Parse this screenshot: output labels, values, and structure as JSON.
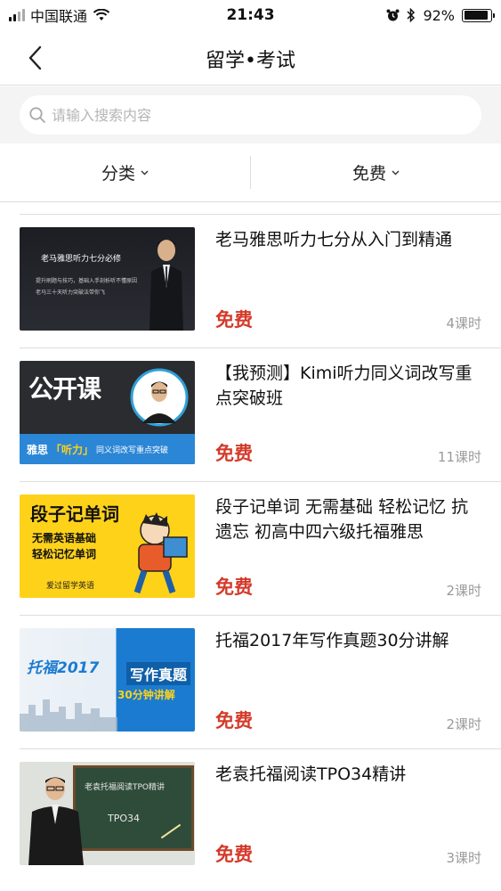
{
  "status_bar": {
    "carrier": "中国联通",
    "time": "21:43",
    "battery": "92%",
    "battery_level": 0.92
  },
  "nav": {
    "title": "留学•考试",
    "back_icon": "chevron-left-icon"
  },
  "search": {
    "placeholder": "请输入搜索内容",
    "icon": "search-icon"
  },
  "filters": [
    {
      "label": "分类"
    },
    {
      "label": "免费"
    }
  ],
  "courses": [
    {
      "title": "老马雅思听力七分从入门到精通",
      "price": "免费",
      "lessons": "4课时",
      "thumb": {
        "lines": [
          "老马雅思听力七分必修",
          "提升刷题与技巧，基础入手剖析听不懂原因",
          "老马三十天听力突破法带你飞"
        ]
      }
    },
    {
      "title": "【我预测】Kimi听力同义词改写重点突破班",
      "price": "免费",
      "lessons": "11课时",
      "thumb": {
        "brand": "公开课",
        "tag1": "雅思",
        "tag2": "「听力」",
        "tag3": "同义词改写重点突破"
      }
    },
    {
      "title": "段子记单词 无需基础 轻松记忆 抗遗忘 初高中四六级托福雅思",
      "price": "免费",
      "lessons": "2课时",
      "thumb": {
        "headline": "段子记单词",
        "line1": "无需英语基础",
        "line2": "轻松记忆单词",
        "brand": "爱过留学英语"
      }
    },
    {
      "title": "托福2017年写作真题30分讲解",
      "price": "免费",
      "lessons": "2课时",
      "thumb": {
        "left": "托福2017",
        "right1": "写作真题",
        "right2": "30分钟讲解"
      }
    },
    {
      "title": "老袁托福阅读TPO34精讲",
      "price": "免费",
      "lessons": "3课时",
      "thumb": {
        "board1": "老袁托福阅读TPO精讲",
        "board2": "TPO34"
      }
    }
  ]
}
